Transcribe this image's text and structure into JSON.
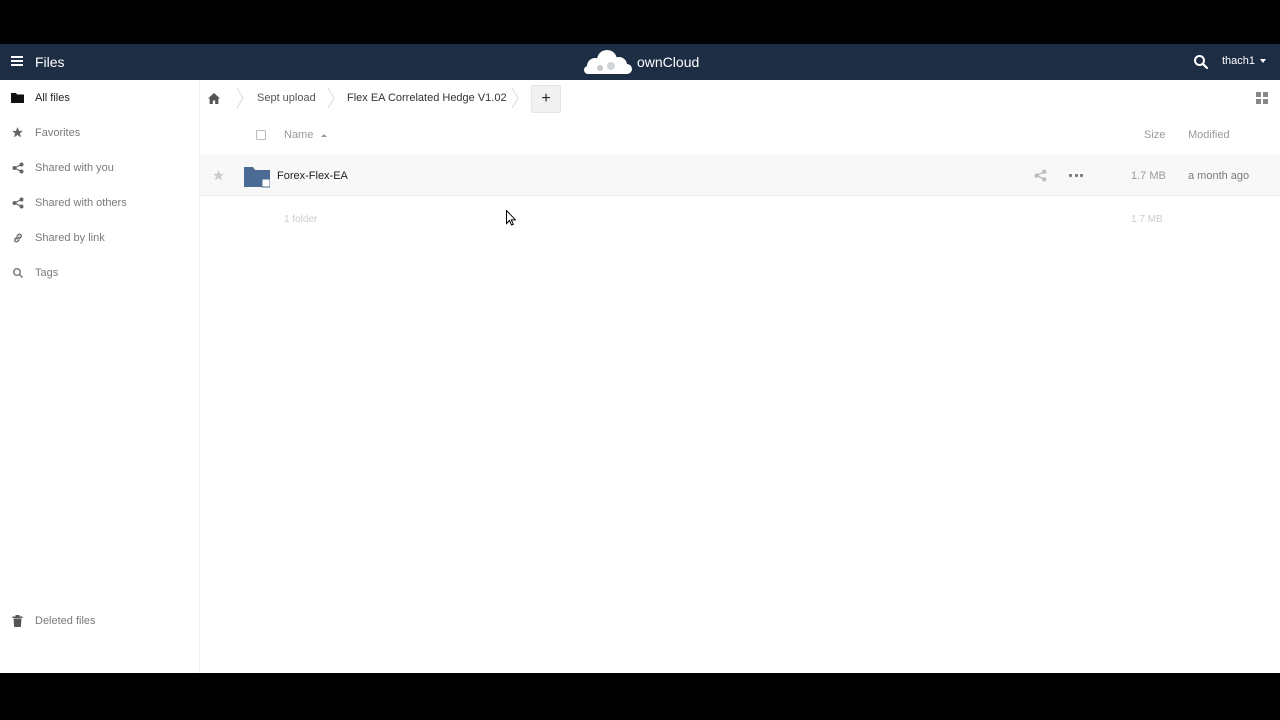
{
  "header": {
    "app_title": "Files",
    "logo_text": "ownCloud",
    "username": "thach1"
  },
  "sidebar": {
    "items": [
      {
        "label": "All files",
        "icon": "folder-icon"
      },
      {
        "label": "Favorites",
        "icon": "star-icon"
      },
      {
        "label": "Shared with you",
        "icon": "share-icon"
      },
      {
        "label": "Shared with others",
        "icon": "share-icon"
      },
      {
        "label": "Shared by link",
        "icon": "link-icon"
      },
      {
        "label": "Tags",
        "icon": "search-icon"
      }
    ],
    "bottom": {
      "deleted": "Deleted files"
    }
  },
  "breadcrumbs": [
    "Sept upload",
    "Flex EA Correlated Hedge V1.02"
  ],
  "toolbar": {
    "add_label": "+"
  },
  "table": {
    "columns": {
      "name": "Name",
      "size": "Size",
      "modified": "Modified"
    },
    "rows": [
      {
        "name": "Forex-Flex-EA",
        "size": "1.7 MB",
        "modified": "a month ago"
      }
    ],
    "summary": {
      "count": "1 folder",
      "size": "1.7 MB"
    }
  },
  "colors": {
    "header_bg": "#1d2d44",
    "folder": "#4b6b94",
    "confirm": "#1fcf6a"
  }
}
